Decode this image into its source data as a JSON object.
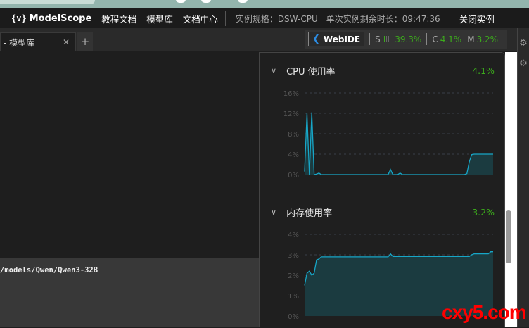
{
  "topbar": {
    "logo_text": "ModelScope",
    "nav": [
      "教程文档",
      "模型库",
      "文档中心"
    ],
    "instance_spec": "实例规格：DSW-CPU",
    "remaining_time": "单次实例剩余时长：09:47:36",
    "close_instance": "关闭实例"
  },
  "editor_tabs": {
    "active_tab": "- 模型库",
    "close_glyph": "✕",
    "add_glyph": "+"
  },
  "status_bar": {
    "webide_label": "WebIDE",
    "storage_label": "S",
    "storage_value": "39.3%",
    "storage_level": 0.393,
    "cpu_label": "C",
    "cpu_value": "4.1%",
    "mem_label": "M",
    "mem_value": "3.2%",
    "accent_green": "#3cab1c"
  },
  "terminal": {
    "line": "/models/Qwen/Qwen3-32B"
  },
  "watermark": "cxy5.com",
  "chart_data": [
    {
      "type": "area",
      "title": "CPU 使用率",
      "current_value": "4.1%",
      "ylim": [
        0,
        16
      ],
      "yticks": [
        "0%",
        "4%",
        "8%",
        "12%",
        "16%"
      ],
      "grid": true,
      "color": "#17a6c7",
      "values": [
        0.6,
        12,
        0,
        12.2,
        0,
        0.1,
        0.3,
        0,
        0,
        0,
        0,
        0,
        0,
        0,
        0,
        0,
        0,
        0,
        0,
        0,
        0,
        0,
        0,
        0,
        0,
        0,
        0,
        0,
        0,
        0,
        0,
        0,
        0,
        0,
        0,
        0,
        1.0,
        0,
        0,
        0,
        0.3,
        0,
        0,
        0,
        0,
        0,
        0,
        0,
        0,
        0,
        0,
        0,
        0,
        0,
        0,
        0,
        0,
        0,
        0,
        0,
        0,
        0,
        0,
        0,
        0,
        0,
        0,
        0,
        0.2,
        2.5,
        3.9,
        4.0,
        4.0,
        4.0,
        4.0,
        4.0,
        4.0,
        4.0,
        4.0,
        4.0
      ]
    },
    {
      "type": "area",
      "title": "内存使用率",
      "current_value": "3.2%",
      "ylim": [
        0,
        4
      ],
      "yticks": [
        "0%",
        "1%",
        "2%",
        "3%",
        "4%"
      ],
      "grid": true,
      "color": "#17a6c7",
      "values": [
        1.5,
        2.1,
        2.2,
        2.0,
        2.1,
        2.75,
        2.8,
        2.9,
        2.9,
        2.9,
        2.9,
        2.9,
        2.9,
        2.9,
        2.9,
        2.9,
        2.9,
        2.9,
        2.9,
        2.9,
        2.9,
        2.9,
        2.9,
        2.9,
        2.9,
        2.9,
        2.9,
        2.9,
        2.9,
        2.9,
        2.9,
        2.9,
        2.9,
        2.9,
        2.9,
        2.9,
        3.05,
        2.92,
        2.92,
        2.92,
        2.92,
        2.92,
        2.92,
        2.92,
        2.92,
        2.92,
        2.92,
        2.92,
        2.92,
        2.92,
        2.92,
        2.92,
        2.92,
        2.92,
        2.92,
        2.92,
        2.92,
        2.92,
        2.92,
        2.92,
        2.92,
        2.92,
        2.92,
        2.92,
        2.92,
        2.92,
        2.92,
        2.92,
        2.92,
        2.92,
        3.0,
        3.05,
        3.05,
        3.05,
        3.05,
        3.05,
        3.05,
        3.05,
        3.15,
        3.15
      ]
    }
  ]
}
